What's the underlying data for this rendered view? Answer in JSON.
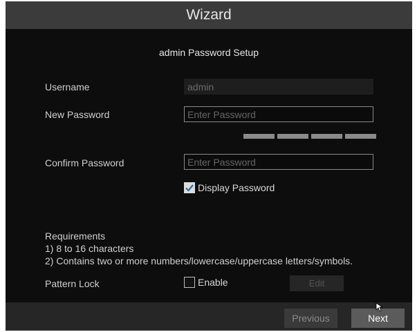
{
  "window": {
    "title": "Wizard"
  },
  "section": {
    "subtitle": "admin Password Setup"
  },
  "form": {
    "username_label": "Username",
    "username_value": "admin",
    "new_password_label": "New Password",
    "new_password_placeholder": "Enter Password",
    "confirm_password_label": "Confirm Password",
    "confirm_password_placeholder": "Enter Password",
    "display_password_label": "Display Password",
    "display_password_checked": true
  },
  "requirements": {
    "heading": "Requirements",
    "items": [
      "1) 8 to 16 characters",
      "2) Contains two or more numbers/lowercase/uppercase letters/symbols."
    ]
  },
  "pattern_lock": {
    "label": "Pattern Lock",
    "enable_label": "Enable",
    "enabled": false,
    "edit_label": "Edit"
  },
  "footer": {
    "previous_label": "Previous",
    "next_label": "Next"
  },
  "colors": {
    "title_bar": "#3b3b3b",
    "background": "#0d0d0d",
    "footer": "#262626"
  }
}
